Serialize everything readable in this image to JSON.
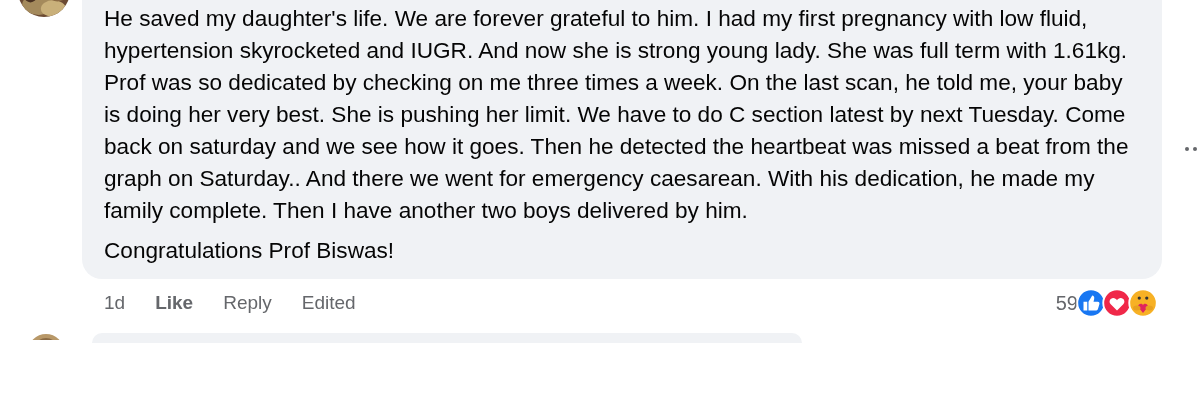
{
  "comment": {
    "paragraphs": [
      "He saved my daughter's life. We are forever grateful to him. I had my first pregnancy with low fluid, hypertension skyrocketed and IUGR. And now she is strong young lady. She was full term with 1.61kg. Prof was so dedicated by checking on me three times a week. On the last scan, he told me, your baby is doing her very best. She is pushing her limit. We have to do C section latest by next Tuesday. Come back on saturday and we see how it goes. Then he detected the heartbeat was missed a beat from the graph on Saturday.. And there we went for emergency caesarean. With his dedication, he made my family complete. Then I have another two boys delivered by him.",
      "Congratulations Prof Biswas!"
    ],
    "timestamp": "1d",
    "actions": [
      {
        "kind": "like",
        "label": "Like"
      },
      {
        "kind": "reply",
        "label": "Reply"
      },
      {
        "kind": "status",
        "label": "Edited"
      }
    ],
    "reaction_count": "59",
    "reactions": [
      {
        "kind": "like"
      },
      {
        "kind": "love"
      },
      {
        "kind": "care"
      }
    ]
  }
}
